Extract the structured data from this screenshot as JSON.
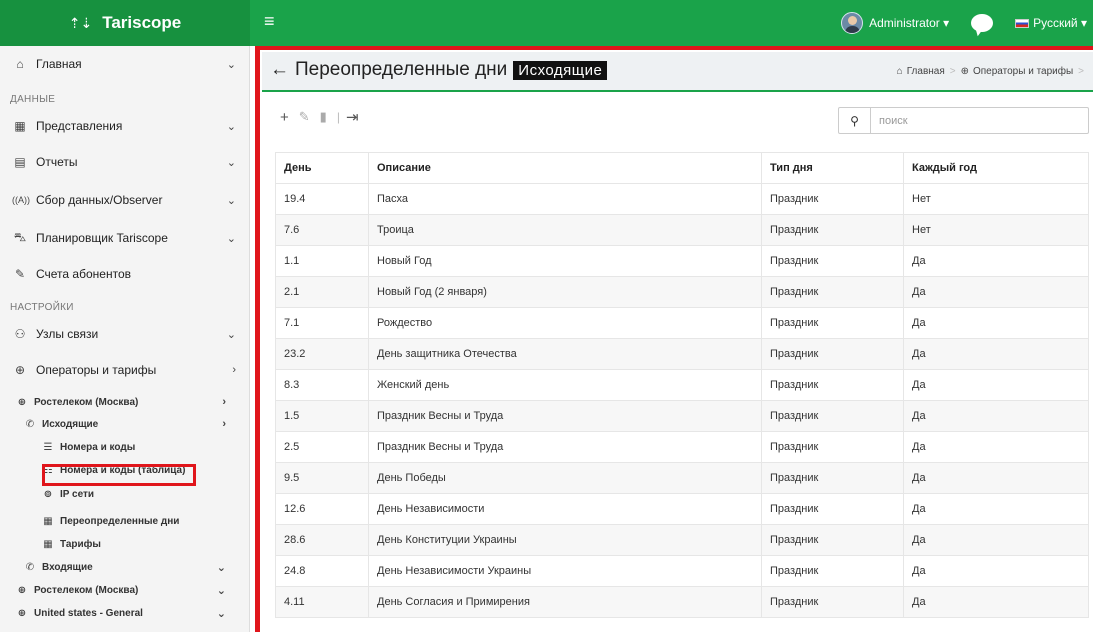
{
  "brand": {
    "name": "Tariscope",
    "logo_glyph": "⇡⇣"
  },
  "topbar": {
    "menu_glyph": "≡",
    "user": "Administrator ▾",
    "language": "Русский ▾"
  },
  "sidebar": {
    "items": [
      {
        "label": "Главная",
        "icon": "⌂"
      },
      {
        "label": "Представления",
        "icon": "▦"
      },
      {
        "label": "Отчеты",
        "icon": "▤"
      },
      {
        "label": "Сбор данных/Observer",
        "icon": "((A))"
      },
      {
        "label": "Планировщик Tariscope",
        "icon": "⛍"
      },
      {
        "label": "Счета абонентов",
        "icon": "✎"
      },
      {
        "label": "Узлы связи",
        "icon": "⚇"
      },
      {
        "label": "Операторы и тарифы",
        "icon": "⊕"
      }
    ],
    "section_data": "ДАННЫЕ",
    "section_settings": "НАСТРОЙКИ",
    "sub": {
      "rostelecom1": "Ростелеком (Москва)",
      "outgoing": "Исходящие",
      "numbers": "Номера и коды",
      "numbers_table": "Номера и коды (таблица)",
      "ip": "IP сети",
      "override_days": "Переопределенные дни",
      "tariffs": "Тарифы",
      "incoming": "Входящие",
      "rostelecom2": "Ростелеком (Москва)",
      "us_general": "United states - General"
    }
  },
  "header": {
    "title": "Переопределенные дни",
    "badge": "Исходящие",
    "breadcrumb": [
      "Главная",
      "Операторы и тарифы"
    ]
  },
  "search": {
    "placeholder": "поиск"
  },
  "table": {
    "columns": [
      "День",
      "Описание",
      "Тип дня",
      "Каждый год"
    ],
    "rows": [
      [
        "19.4",
        "Пасха",
        "Праздник",
        "Нет"
      ],
      [
        "7.6",
        "Троица",
        "Праздник",
        "Нет"
      ],
      [
        "1.1",
        "Новый Год",
        "Праздник",
        "Да"
      ],
      [
        "2.1",
        "Новый Год (2 января)",
        "Праздник",
        "Да"
      ],
      [
        "7.1",
        "Рождество",
        "Праздник",
        "Да"
      ],
      [
        "23.2",
        "День защитника Отечества",
        "Праздник",
        "Да"
      ],
      [
        "8.3",
        "Женский день",
        "Праздник",
        "Да"
      ],
      [
        "1.5",
        "Праздник Весны и Труда",
        "Праздник",
        "Да"
      ],
      [
        "2.5",
        "Праздник Весны и Труда",
        "Праздник",
        "Да"
      ],
      [
        "9.5",
        "День Победы",
        "Праздник",
        "Да"
      ],
      [
        "12.6",
        "День Независимости",
        "Праздник",
        "Да"
      ],
      [
        "28.6",
        "День Конституции Украины",
        "Праздник",
        "Да"
      ],
      [
        "24.8",
        "День Независимости Украины",
        "Праздник",
        "Да"
      ],
      [
        "4.11",
        "День Согласия и Примирения",
        "Праздник",
        "Да"
      ]
    ]
  },
  "colors": {
    "accent": "#1aa34a",
    "highlight": "#e0151b"
  }
}
